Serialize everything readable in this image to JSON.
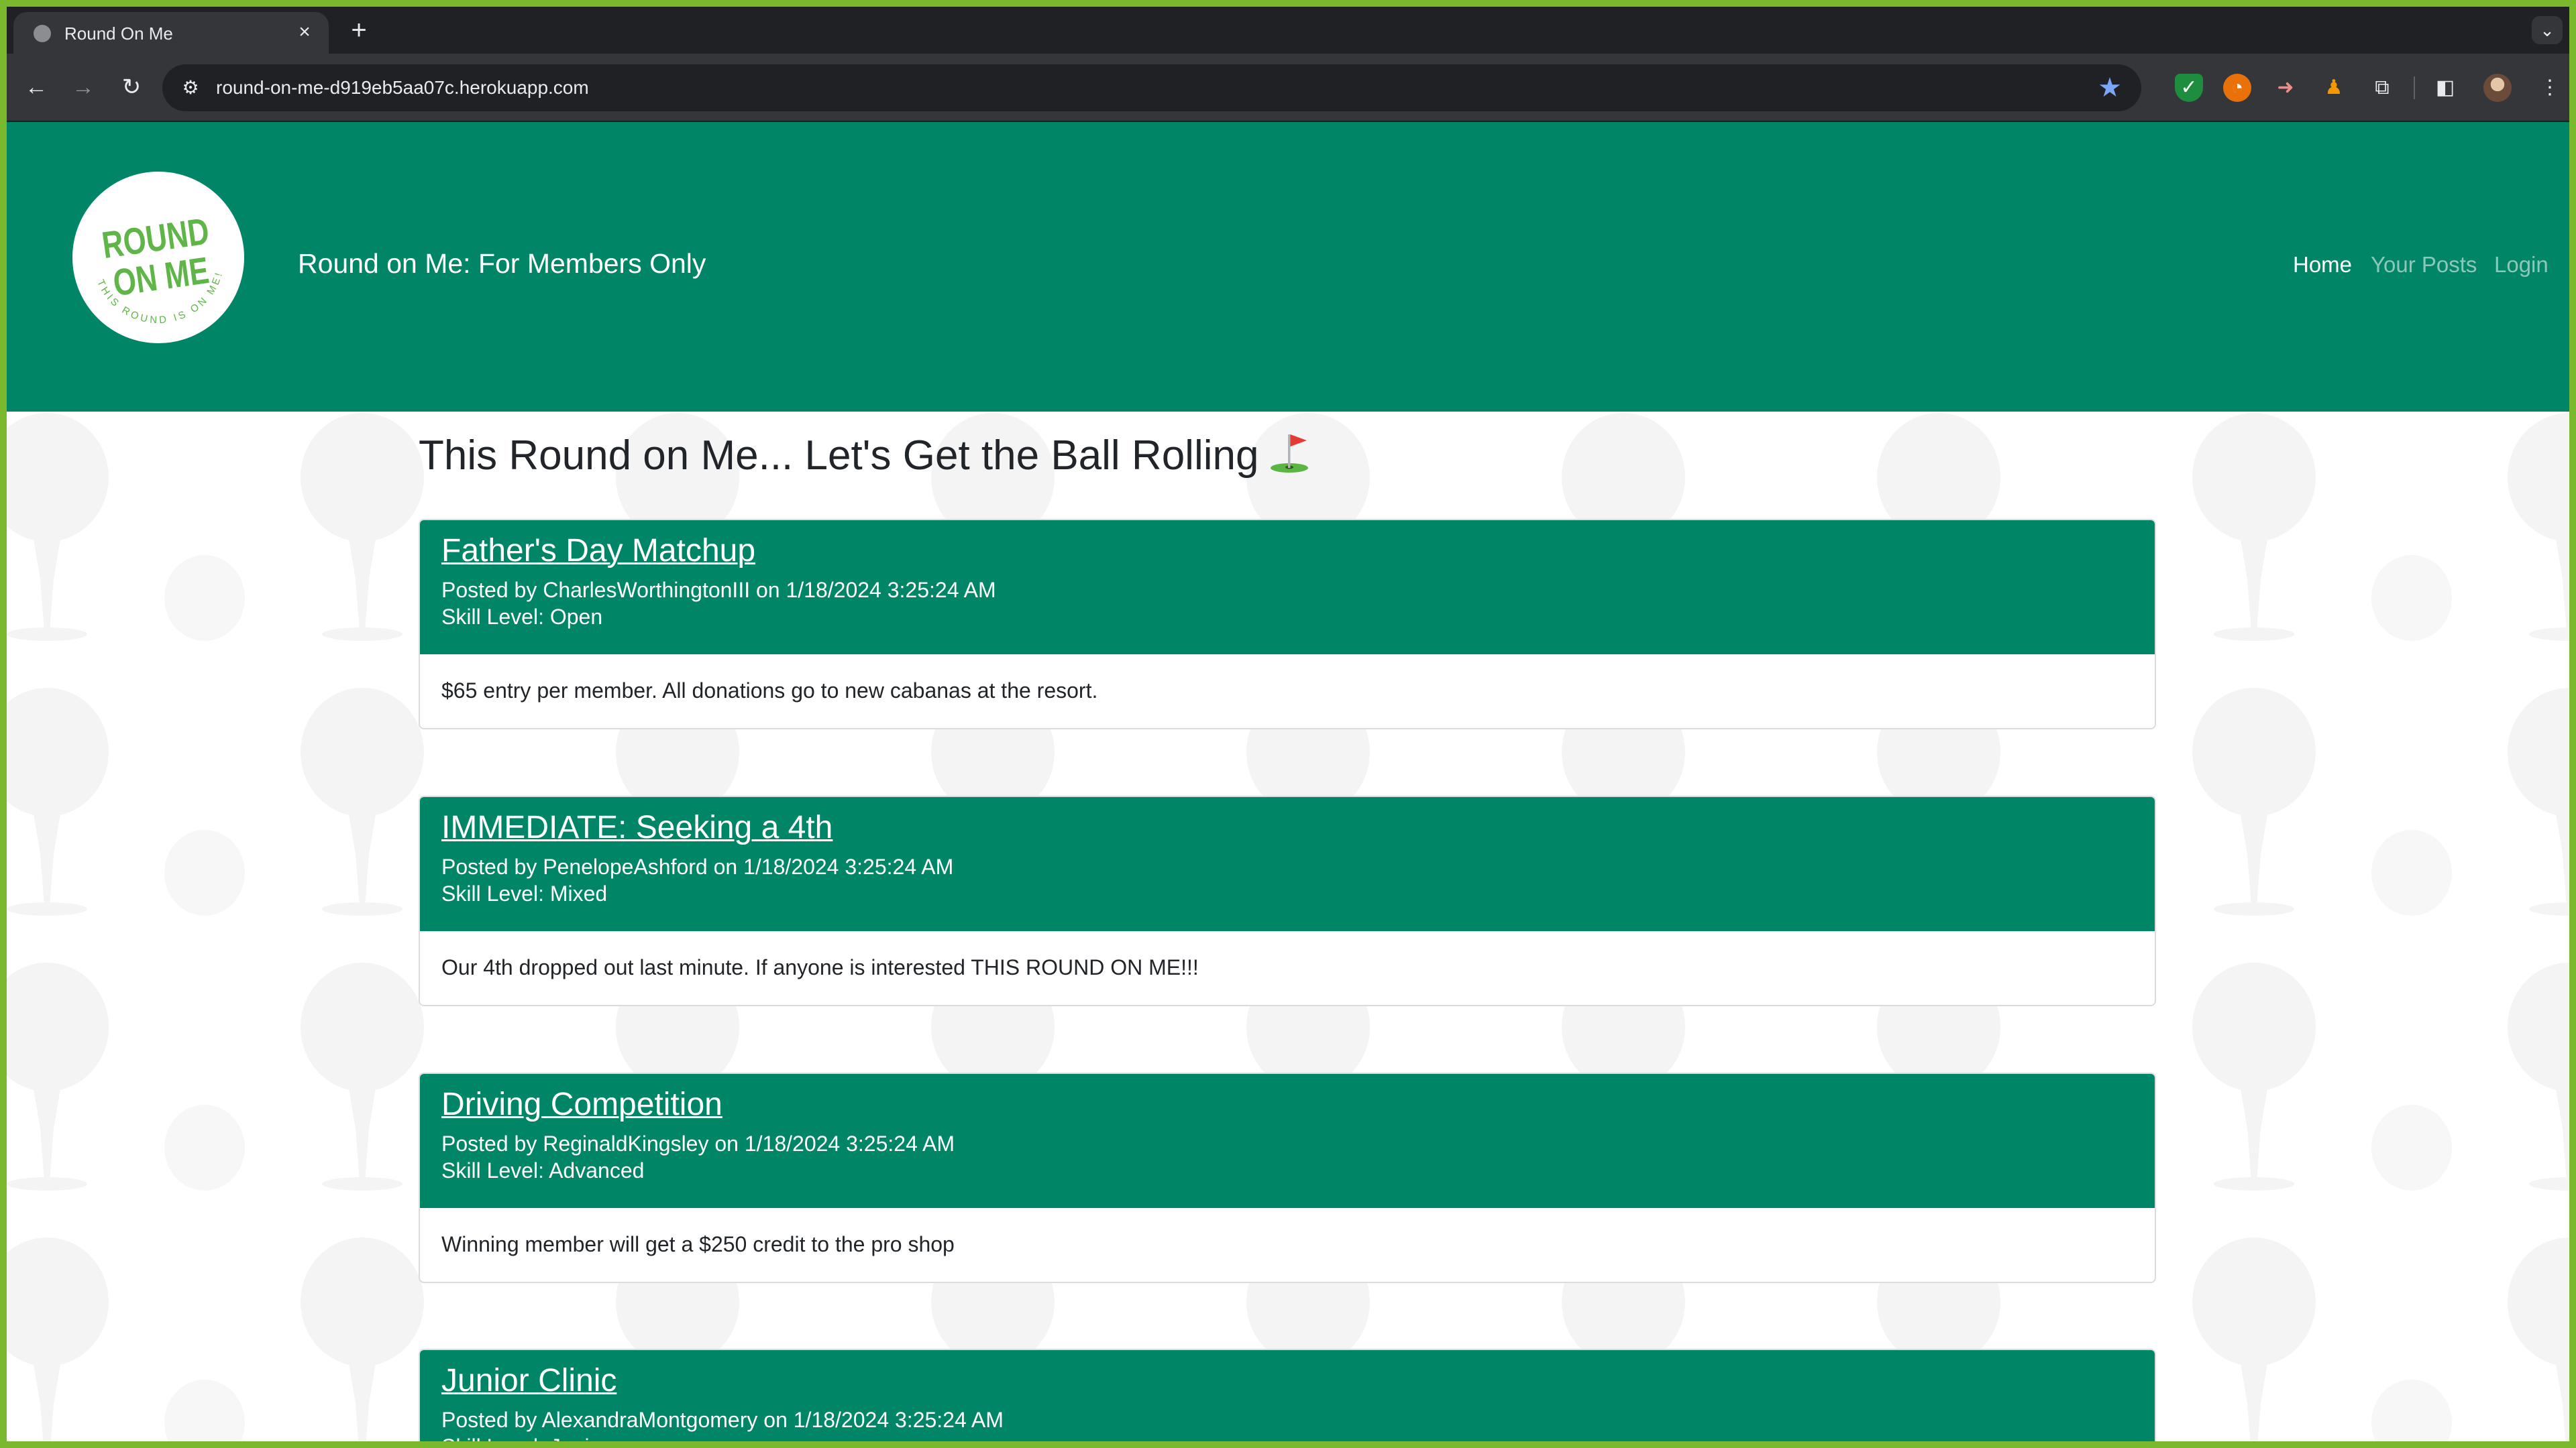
{
  "browser": {
    "tab_title": "Round On Me",
    "url": "round-on-me-d919eb5aa07c.herokuapp.com"
  },
  "site": {
    "title": "Round on Me: For Members Only",
    "logo": {
      "main_line1": "ROUND",
      "main_line2": "ON ME",
      "ring_text": "THIS ROUND IS ON ME!"
    },
    "nav": [
      {
        "label": "Home",
        "active": true
      },
      {
        "label": "Your Posts",
        "active": false
      },
      {
        "label": "Login",
        "active": false
      }
    ]
  },
  "page": {
    "heading": "This Round on Me... Let's Get the Ball Rolling"
  },
  "posts": [
    {
      "title": "Father's Day Matchup",
      "author": "CharlesWorthingtonIII",
      "date": "1/18/2024 3:25:24 AM",
      "skill": "Open",
      "body": "$65 entry per member. All donations go to new cabanas at the resort."
    },
    {
      "title": "IMMEDIATE: Seeking a 4th",
      "author": "PenelopeAshford",
      "date": "1/18/2024 3:25:24 AM",
      "skill": "Mixed",
      "body": "Our 4th dropped out last minute. If anyone is interested THIS ROUND ON ME!!!"
    },
    {
      "title": "Driving Competition",
      "author": "ReginaldKingsley",
      "date": "1/18/2024 3:25:24 AM",
      "skill": "Advanced",
      "body": "Winning member will get a $250 credit to the pro shop"
    },
    {
      "title": "Junior Clinic",
      "author": "AlexandraMontgomery",
      "date": "1/18/2024 3:25:24 AM",
      "skill": "Junior",
      "body": ""
    }
  ],
  "colors": {
    "header_green": "#008566",
    "logo_green": "#5fb547",
    "window_border": "#7ab82e"
  }
}
